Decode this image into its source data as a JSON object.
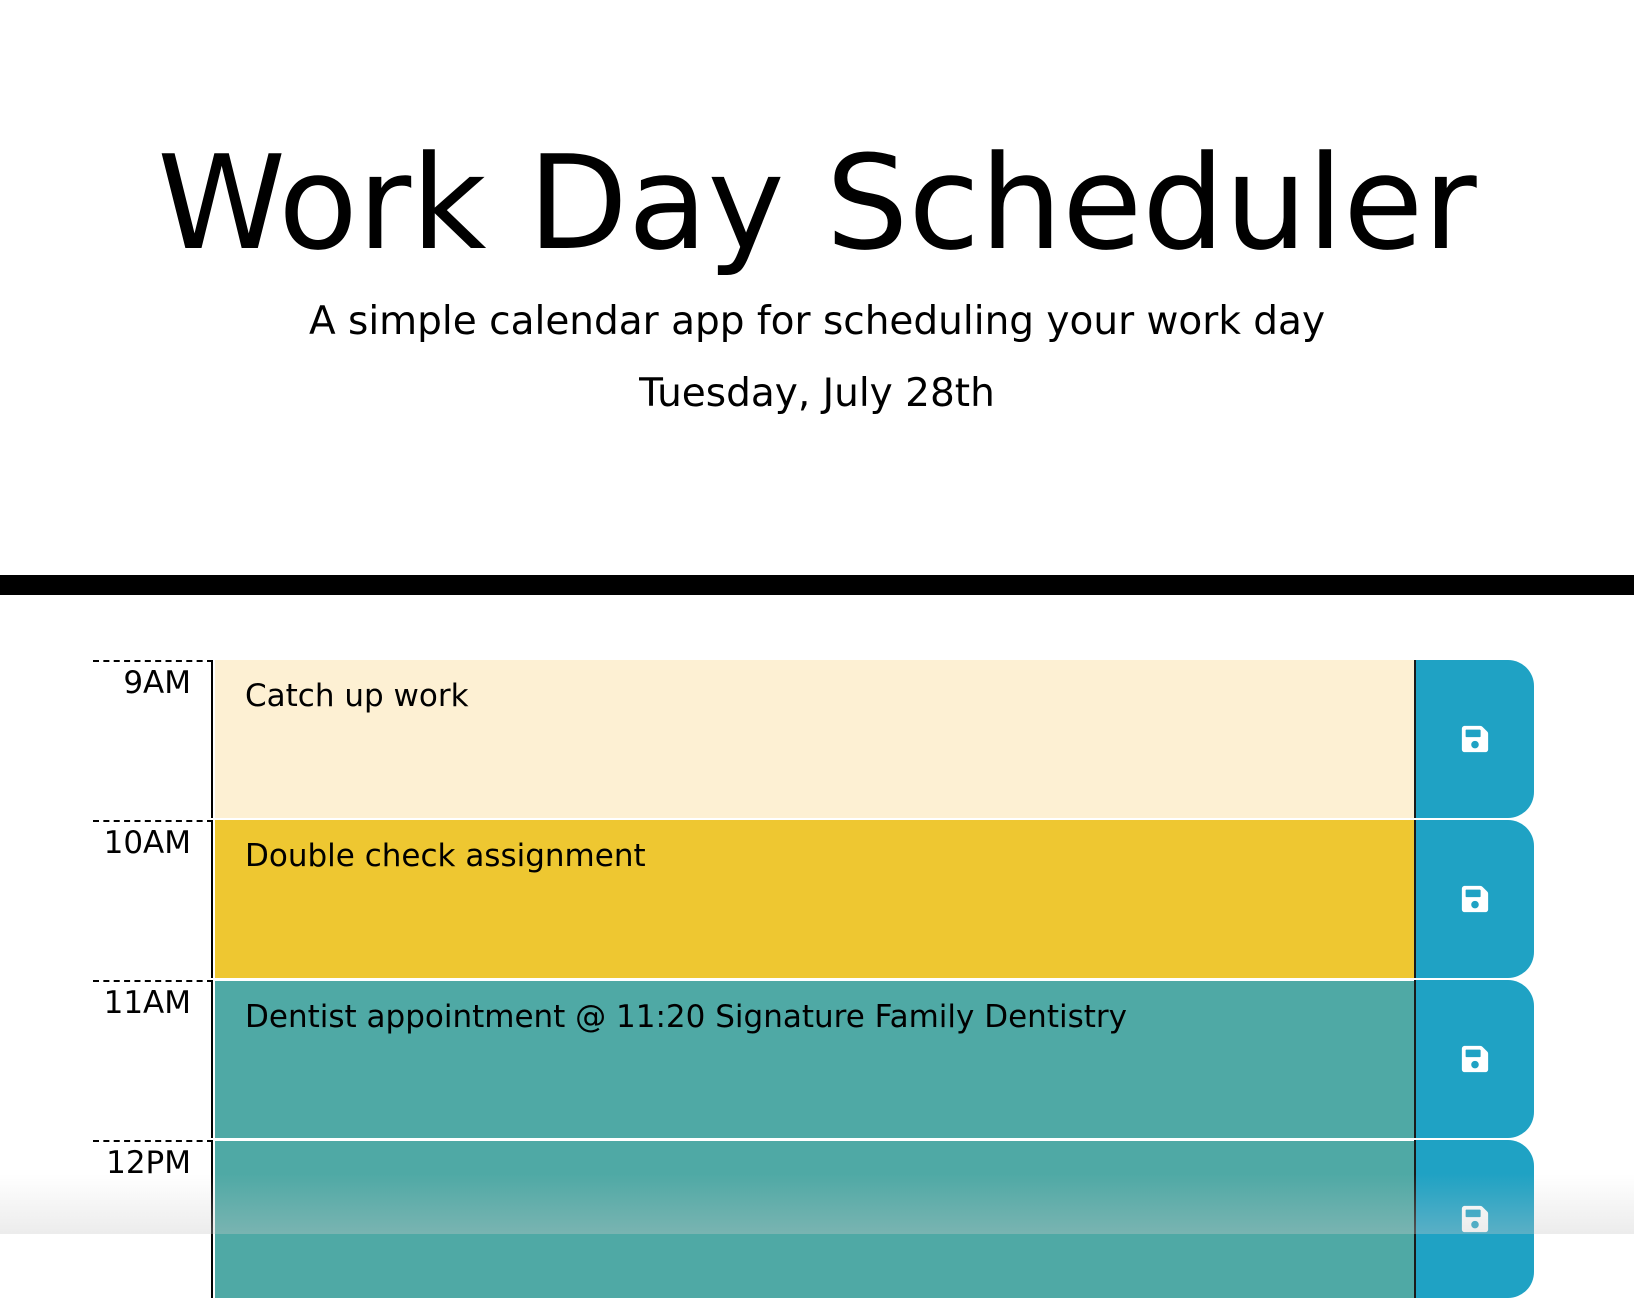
{
  "header": {
    "title": "Work Day Scheduler",
    "subtitle": "A simple calendar app for scheduling your work day",
    "current_date": "Tuesday, July 28th"
  },
  "colors": {
    "past": "#fdf0d3",
    "present": "#eec731",
    "future": "#4fa9a5",
    "save_button": "#1fa2c4",
    "divider": "#000000"
  },
  "timeblocks": [
    {
      "hour": "9AM",
      "text": "Catch up work",
      "status": "past",
      "save_icon": "save-icon"
    },
    {
      "hour": "10AM",
      "text": "Double check assignment",
      "status": "present",
      "save_icon": "save-icon"
    },
    {
      "hour": "11AM",
      "text": "Dentist appointment @ 11:20 Signature Family Dentistry",
      "status": "future",
      "save_icon": "save-icon"
    },
    {
      "hour": "12PM",
      "text": "",
      "status": "future",
      "save_icon": "save-icon"
    }
  ]
}
